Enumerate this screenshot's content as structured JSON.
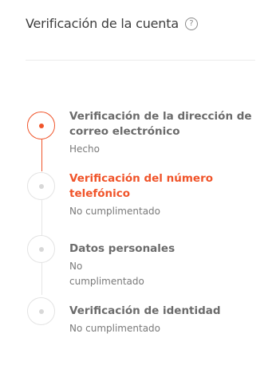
{
  "header": {
    "title": "Verificación de la cuenta",
    "help_icon": "?"
  },
  "steps": [
    {
      "title_line1": "Verificación de la dirección de",
      "title_line2": "correo electrónico",
      "status": "Hecho"
    },
    {
      "title_line1": "Verificación del número",
      "title_line2": "telefónico",
      "status": "No cumplimentado"
    },
    {
      "title_line1": "Datos personales",
      "status_line1": "No",
      "status_line2": "cumplimentado"
    },
    {
      "title_line1": "Verificación de identidad",
      "status": "No cumplimentado"
    }
  ],
  "colors": {
    "accent": "#f0542a",
    "inactive": "#d8d8d8"
  }
}
